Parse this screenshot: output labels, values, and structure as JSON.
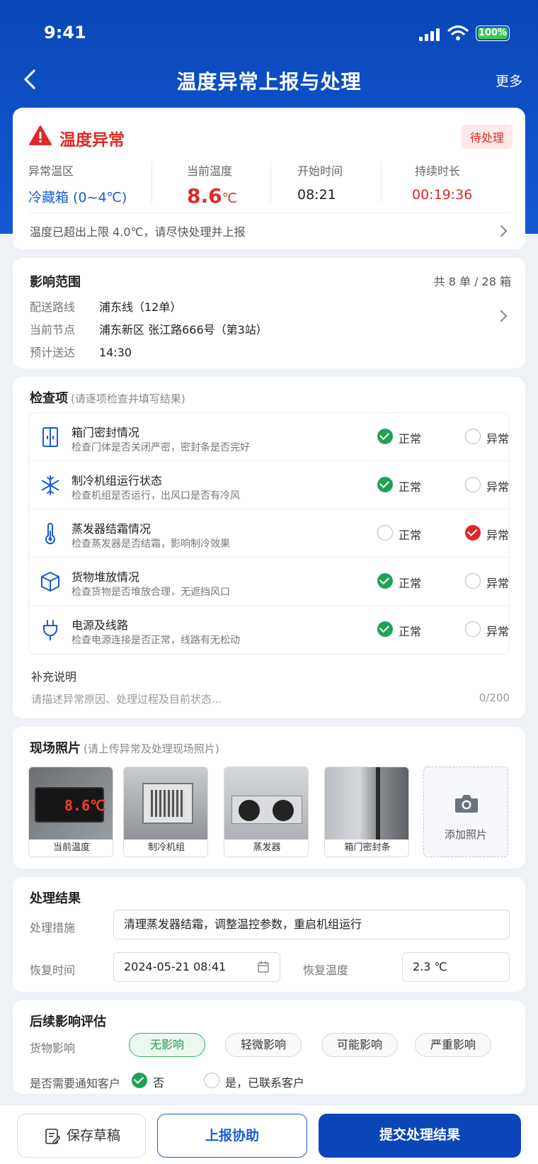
{
  "status_bar": {
    "time": "9:41",
    "battery": "100%"
  },
  "nav": {
    "title": "温度异常上报与处理",
    "more": "更多"
  },
  "alert": {
    "title": "温度异常",
    "badge": "待处理",
    "zone_label": "异常温区",
    "zone_value": "冷藏箱 (0~4℃)",
    "temp_label": "当前温度",
    "temp_value": "8.6",
    "temp_unit": "℃",
    "start_label": "开始时间",
    "start_value": "08:21",
    "duration_label": "持续时长",
    "duration_value": "00:19:36",
    "tip": "温度已超出上限 4.0℃，请尽快处理并上报",
    "colors": {
      "danger": "#e02828",
      "zone": "#1a5bd6"
    }
  },
  "impact": {
    "title": "影响范围",
    "count": "共 8 单 / 28 箱",
    "route_label": "配送路线",
    "route_value": "浦东线（12单）",
    "node_label": "当前节点",
    "node_value": "浦东新区 张江路666号（第3站）",
    "eta_label": "预计送达",
    "eta_value": "14:30"
  },
  "check": {
    "title": "检查项",
    "hint": "(请逐项检查并填写结果)",
    "normal_label": "正常",
    "abnormal_label": "异常",
    "items": [
      {
        "name": "箱门密封情况",
        "desc": "检查门体是否关闭严密，密封条是否完好",
        "icon": "door-icon",
        "result": "normal"
      },
      {
        "name": "制冷机组运行状态",
        "desc": "检查机组是否运行，出风口是否有冷风",
        "icon": "snowflake-icon",
        "result": "normal"
      },
      {
        "name": "蒸发器结霜情况",
        "desc": "检查蒸发器是否结霜，影响制冷效果",
        "icon": "thermometer-icon",
        "result": "abnormal"
      },
      {
        "name": "货物堆放情况",
        "desc": "检查货物是否堆放合理，无遮挡风口",
        "icon": "box-icon",
        "result": "normal"
      },
      {
        "name": "电源及线路",
        "desc": "检查电源连接是否正常，线路有无松动",
        "icon": "plug-icon",
        "result": "normal"
      }
    ],
    "note_title": "补充说明",
    "note_placeholder": "请描述异常原因、处理过程及目前状态...",
    "note_count": "0/200"
  },
  "photos": {
    "title": "现场照片",
    "hint": "(请上传异常及处理现场照片)",
    "items": [
      {
        "caption": "当前温度",
        "display_text": "8.6℃"
      },
      {
        "caption": "制冷机组"
      },
      {
        "caption": "蒸发器"
      },
      {
        "caption": "箱门密封条"
      }
    ],
    "add_label": "添加照片"
  },
  "result": {
    "title": "处理结果",
    "measure_label": "处理措施",
    "measure_value": "清理蒸发器结霜，调整温控参数，重启机组运行",
    "recover_time_label": "恢复时间",
    "recover_time_value": "2024-05-21 08:41",
    "recover_temp_label": "恢复温度",
    "recover_temp_value": "2.3 ℃"
  },
  "evaluation": {
    "title": "后续影响评估",
    "goods_label": "货物影响",
    "options": [
      "无影响",
      "轻微影响",
      "可能影响",
      "严重影响"
    ],
    "selected": "无影响",
    "notify_label": "是否需要通知客户",
    "notify_no": "否",
    "notify_yes": "是，已联系客户"
  },
  "footer": {
    "draft": "保存草稿",
    "help": "上报协助",
    "submit": "提交处理结果"
  }
}
